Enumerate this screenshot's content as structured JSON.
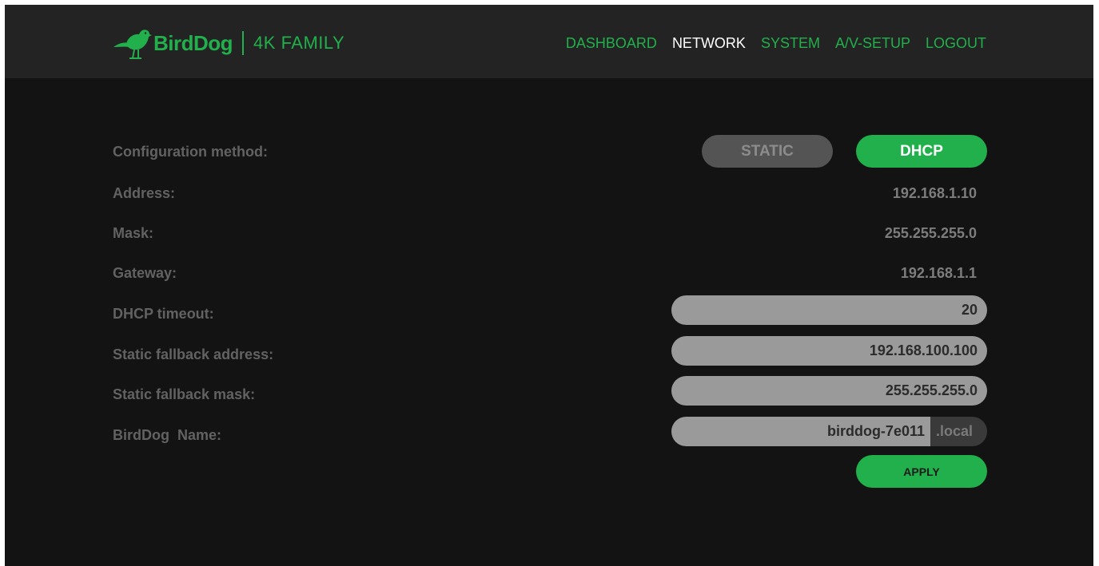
{
  "brand": {
    "name": "BirdDog",
    "family": "4K FAMILY",
    "logo_icon": "bird-logo-icon",
    "accent_color": "#21b04b"
  },
  "nav": {
    "dashboard": "DASHBOARD",
    "network": "NETWORK",
    "system": "SYSTEM",
    "av_setup": "A/V-SETUP",
    "logout": "LOGOUT",
    "active": "NETWORK"
  },
  "form": {
    "config_method": {
      "label": "Configuration method:",
      "options": [
        "STATIC",
        "DHCP"
      ],
      "selected": "DHCP"
    },
    "address": {
      "label": "Address:",
      "value": "192.168.1.10"
    },
    "mask": {
      "label": "Mask:",
      "value": "255.255.255.0"
    },
    "gateway": {
      "label": "Gateway:",
      "value": "192.168.1.1"
    },
    "dhcp_timeout": {
      "label": "DHCP timeout:",
      "value": "20"
    },
    "fallback_address": {
      "label": "Static fallback address:",
      "value": "192.168.100.100"
    },
    "fallback_mask": {
      "label": "Static fallback mask:",
      "value": "255.255.255.0"
    },
    "birddog_name": {
      "label": "BirdDog  Name:",
      "value": "birddog-7e011",
      "suffix": ".local"
    },
    "apply_label": "APPLY"
  }
}
